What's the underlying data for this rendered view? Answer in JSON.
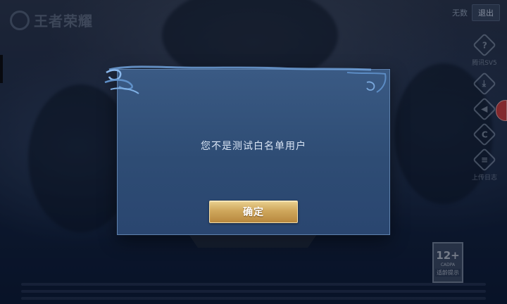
{
  "header": {
    "logo_text": "王者荣耀",
    "status_text": "无数",
    "logout_label": "退出"
  },
  "side_tools": [
    {
      "icon": "help-icon",
      "glyph": "?",
      "label": "腾讯SV5"
    },
    {
      "icon": "download-icon",
      "glyph": "⤓",
      "label": ""
    },
    {
      "icon": "sound-icon",
      "glyph": "◀",
      "label": ""
    },
    {
      "icon": "refresh-icon",
      "glyph": "C",
      "label": ""
    },
    {
      "icon": "log-icon",
      "glyph": "≡",
      "label": "上传日志"
    }
  ],
  "age_rating": {
    "number": "12+",
    "org": "CADPA",
    "tip": "适龄提示"
  },
  "dialog": {
    "message": "您不是测试白名单用户",
    "confirm_label": "确定"
  },
  "colors": {
    "dialog_bg": "#3a5a84",
    "dialog_border": "#5f82ad",
    "button_gold": "#cfa75c",
    "background": "#0d1a30"
  }
}
